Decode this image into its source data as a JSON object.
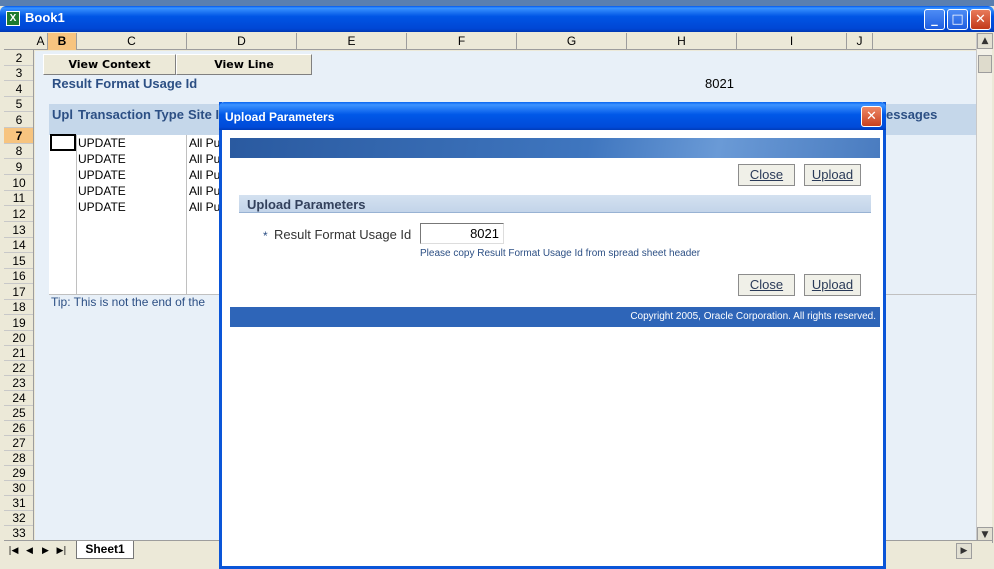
{
  "window": {
    "title": "Book1",
    "icon": "excel-icon"
  },
  "columns": [
    "A",
    "B",
    "C",
    "D",
    "E",
    "F",
    "G",
    "H",
    "I",
    "J"
  ],
  "selected_column": "B",
  "rows": [
    "2",
    "3",
    "4",
    "5",
    "6",
    "7",
    "8",
    "9",
    "10",
    "11",
    "12",
    "13",
    "14",
    "15",
    "16",
    "17",
    "18",
    "19",
    "20",
    "21",
    "22",
    "23",
    "24",
    "25",
    "26",
    "27",
    "28",
    "29",
    "30",
    "31",
    "32",
    "33"
  ],
  "selected_row": "7",
  "sheet": {
    "view_context_label": "View Context",
    "view_line_label": "View Line",
    "result_format_label": "Result Format Usage Id",
    "result_format_value": "8021",
    "headers": {
      "upl": "Upl",
      "transaction_type": "Transaction Type",
      "site": "Site I",
      "messages": "essages"
    },
    "transactions": [
      "UPDATE",
      "UPDATE",
      "UPDATE",
      "UPDATE",
      "UPDATE"
    ],
    "sites": [
      "All Pu",
      "All Pu",
      "All Pu",
      "All Pu",
      "All Pu"
    ],
    "tip": "Tip: This is not the end of the"
  },
  "tabs": {
    "sheet1": "Sheet1"
  },
  "dialog": {
    "title": "Upload Parameters",
    "close_label": "Close",
    "upload_label": "Upload",
    "section_title": "Upload Parameters",
    "required_mark": "*",
    "field_label": "Result Format Usage Id",
    "field_value": "8021",
    "hint": "Please copy Result Format Usage Id from spread sheet header",
    "copyright": "Copyright 2005, Oracle Corporation. All rights reserved."
  },
  "colors": {
    "title_blue": "#0058ee",
    "header_band": "#c5d7ea",
    "label_blue": "#2c4f84",
    "footer_blue": "#2e65b8"
  }
}
